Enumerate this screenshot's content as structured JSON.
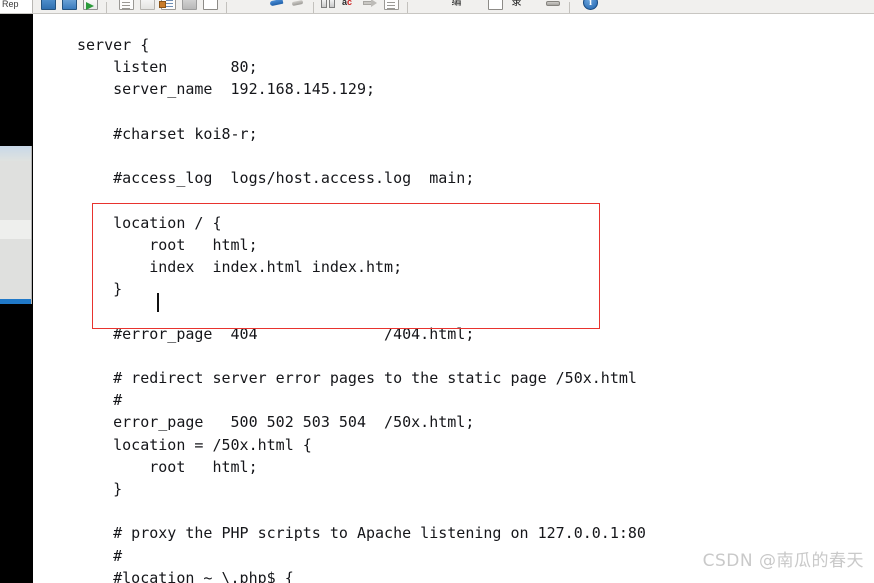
{
  "toolbar": {
    "tab_fragment_label": "Rep",
    "groups": [
      {
        "name": "file-group",
        "buttons": [
          {
            "icon": "save-icon",
            "label": "Save"
          },
          {
            "icon": "save-all-icon",
            "label": "Save All"
          },
          {
            "icon": "run-icon",
            "label": "Run"
          }
        ]
      },
      {
        "name": "clipboard-group",
        "buttons": [
          {
            "icon": "copy-icon",
            "label": "Copy"
          },
          {
            "icon": "paste-icon",
            "label": "Paste"
          },
          {
            "icon": "document-icon",
            "label": "Document"
          },
          {
            "icon": "collapse-icon",
            "label": "Collapse"
          },
          {
            "icon": "zoom-icon",
            "label": "Zoom"
          }
        ]
      },
      {
        "name": "edit-group",
        "buttons": [
          {
            "icon": "highlight-pen-icon",
            "label": "Highlight"
          },
          {
            "icon": "eraser-icon",
            "label": "Erase"
          }
        ]
      },
      {
        "name": "view-group",
        "buttons": [
          {
            "icon": "split-view-icon",
            "label": "Split View"
          },
          {
            "icon": "spellcheck-abc-icon",
            "label": "Spell Check"
          },
          {
            "icon": "word-wrap-icon",
            "label": "Word Wrap"
          },
          {
            "icon": "show-symbols-icon",
            "label": "Show All Characters"
          }
        ]
      },
      {
        "name": "encoding-group",
        "buttons": [
          {
            "icon": "encoding-icon",
            "label": "编码"
          },
          {
            "icon": "blank-window-icon",
            "label": "New Window"
          },
          {
            "icon": "macro-icon",
            "label": "宏录制"
          }
        ]
      },
      {
        "name": "tools-group",
        "buttons": [
          {
            "icon": "plugin-wrench-icon",
            "label": "Plugins"
          }
        ]
      },
      {
        "name": "help-group",
        "buttons": [
          {
            "icon": "help-info-icon",
            "label": "i"
          }
        ]
      }
    ]
  },
  "editor": {
    "code": "server {\n    listen       80;\n    server_name  192.168.145.129;\n\n    #charset koi8-r;\n\n    #access_log  logs/host.access.log  main;\n\n    location / {\n        root   html;\n        index  index.html index.htm;\n    }\n\n    #error_page  404              /404.html;\n\n    # redirect server error pages to the static page /50x.html\n    #\n    error_page   500 502 503 504  /50x.html;\n    location = /50x.html {\n        root   html;\n    }\n\n    # proxy the PHP scripts to Apache listening on 127.0.0.1:80\n    #\n    #location ~ \\.php$ {",
    "annotation": {
      "name": "location-block-highlight",
      "color": "#e8332e"
    },
    "caret_visible": true
  },
  "watermark": {
    "text": "CSDN @南瓜的春天"
  },
  "scrollbar": {
    "name": "vertical-scrollbar",
    "accent": "#2079c8"
  }
}
